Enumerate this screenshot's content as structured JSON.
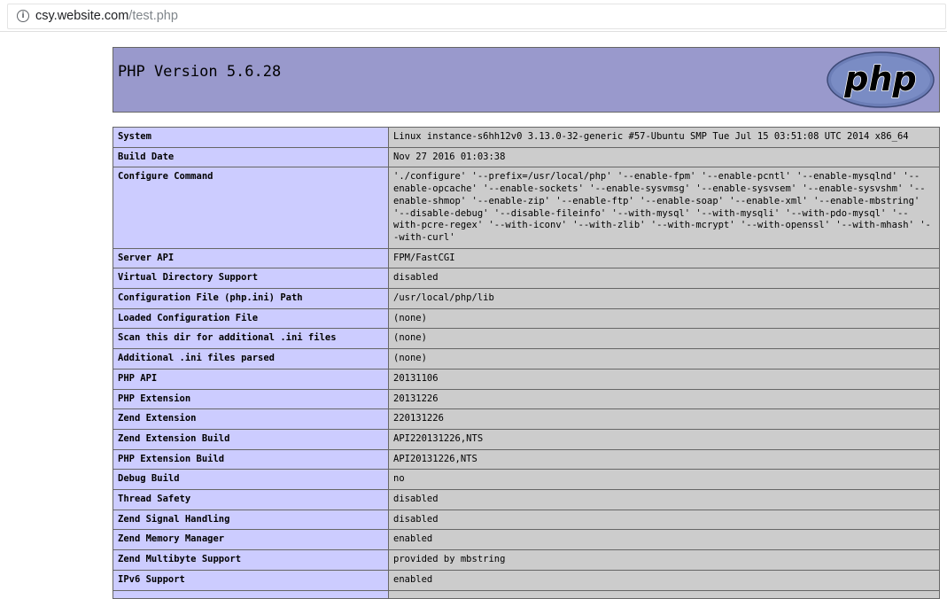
{
  "browser": {
    "url_host": "csy.website.com",
    "url_path": "/test.php"
  },
  "header": {
    "title": "PHP Version 5.6.28",
    "logo_text": "php"
  },
  "rows": [
    {
      "key": "System",
      "value": "Linux instance-s6hh12v0 3.13.0-32-generic #57-Ubuntu SMP Tue Jul 15 03:51:08 UTC 2014 x86_64"
    },
    {
      "key": "Build Date",
      "value": "Nov 27 2016 01:03:38"
    },
    {
      "key": "Configure Command",
      "value": "'./configure' '--prefix=/usr/local/php' '--enable-fpm' '--enable-pcntl' '--enable-mysqlnd' '--enable-opcache' '--enable-sockets' '--enable-sysvmsg' '--enable-sysvsem' '--enable-sysvshm' '--enable-shmop' '--enable-zip' '--enable-ftp' '--enable-soap' '--enable-xml' '--enable-mbstring' '--disable-debug' '--disable-fileinfo' '--with-mysql' '--with-mysqli' '--with-pdo-mysql' '--with-pcre-regex' '--with-iconv' '--with-zlib' '--with-mcrypt' '--with-openssl' '--with-mhash' '--with-curl'"
    },
    {
      "key": "Server API",
      "value": "FPM/FastCGI"
    },
    {
      "key": "Virtual Directory Support",
      "value": "disabled"
    },
    {
      "key": "Configuration File (php.ini) Path",
      "value": "/usr/local/php/lib"
    },
    {
      "key": "Loaded Configuration File",
      "value": "(none)"
    },
    {
      "key": "Scan this dir for additional .ini files",
      "value": "(none)"
    },
    {
      "key": "Additional .ini files parsed",
      "value": "(none)"
    },
    {
      "key": "PHP API",
      "value": "20131106"
    },
    {
      "key": "PHP Extension",
      "value": "20131226"
    },
    {
      "key": "Zend Extension",
      "value": "220131226"
    },
    {
      "key": "Zend Extension Build",
      "value": "API220131226,NTS"
    },
    {
      "key": "PHP Extension Build",
      "value": "API20131226,NTS"
    },
    {
      "key": "Debug Build",
      "value": "no"
    },
    {
      "key": "Thread Safety",
      "value": "disabled"
    },
    {
      "key": "Zend Signal Handling",
      "value": "disabled"
    },
    {
      "key": "Zend Memory Manager",
      "value": "enabled"
    },
    {
      "key": "Zend Multibyte Support",
      "value": "provided by mbstring"
    },
    {
      "key": "IPv6 Support",
      "value": "enabled"
    },
    {
      "key": "",
      "value": ""
    }
  ]
}
